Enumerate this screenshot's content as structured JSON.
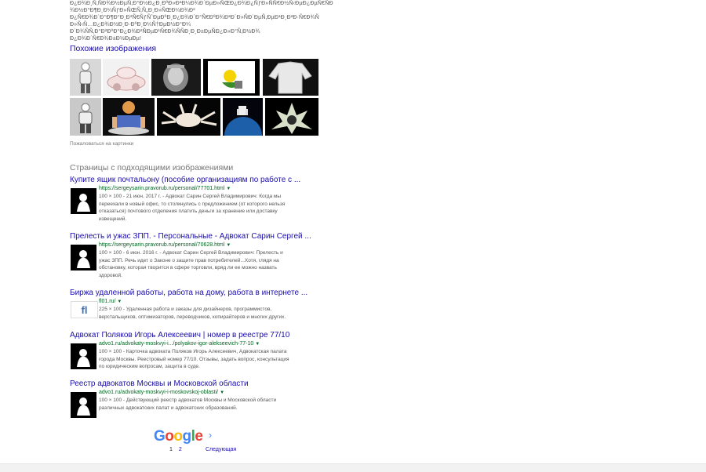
{
  "garbled_text": {
    "line1": "Ð¿Ð¾Ð¸Ñ‚ÑÐ¾Ð½ÐµÑ‚Ð°Ð½Ð¿Ð¸ÐºÐ»Ð²Ð¼Ð¾Ð´ÐµÐ»ÑŒÐ¿Ð¾Ð¿ÑƒÐ»ÑÑ€Ð½Ñ‹ÐµÐ¿ÐµÑ€ÑÐ¾Ð½Ð°Ð¶Ð¸Ð¼ÑƒÐ»ÑŒÑ‚Ñ„Ð¸Ð»ÑŒÐ¼Ð¾Ð²",
    "line2": "Ð¿Ñ€Ð¾Ð´Ð°Ð¶Ð°Ð¸Ð³Ñ€ÑƒÑˆÐµÐºÐ¸Ð¿Ð¾Ð´Ð°Ñ€ÐºÐ¾Ð²Ð´Ð»ÑÐ´ÐµÑ‚ÐµÐ¹Ð¸Ð²Ð·Ñ€Ð¾ÑÐ»Ñ‹Ñ…Ð¿Ð¾Ð½Ð¸Ð·ÐºÐ¸Ð¼Ñ†ÐµÐ½Ð°Ð¼",
    "line3": "Ð´Ð¾ÑÑ‚Ð°Ð²ÐºÐ°Ð¿Ð¾Ð²ÑÐµÐ¹Ñ€Ð¾ÑÑÐ¸Ð¸Ð±ÐµÑÐ¿Ð»Ð°Ñ‚Ð½Ð¾",
    "line4": "Ð¿Ð¾Ð´Ñ€Ð¾Ð±Ð½ÐµÐµ!"
  },
  "similar_images": {
    "title": "Похожие изображения",
    "complain_label": "Пожаловаться на картинки"
  },
  "pages_section": {
    "title": "Страницы с подходящими изображениями",
    "results": [
      {
        "title": "Купите ящик почтальону (пособие организациям по работе с ...",
        "url": "https://sergeysarin.pravorub.ru/personal/77701.html",
        "meta": "100 × 100 - 21 июн. 2017 г. - Адвокат Сарин Сергей Владимирович: Когда мы",
        "snippet_line2": "переехали в новый офис, то столкнулись с предложением (от которого нельзя",
        "snippet_line3": "отказаться) почтового отделения платить деньги за хранение или доставку",
        "snippet_line4": "извещений."
      },
      {
        "title": "Прелесть и ужас ЗПП. - Персональные - Адвокат Сарин Сергей ...",
        "url": "https://sergeysarin.pravorub.ru/personal/70628.html",
        "meta": "100 × 100 - 6 июн. 2016 г. - Адвокат Сарин Сергей Владимирович: Прелесть и",
        "snippet_line2": "ужас ЗПП. Речь идет о Законе о защите прав потребителей...Хотя, глядя на",
        "snippet_line3": "обстановку, которая творится в сфере торговли, вряд ли ее можно назвать",
        "snippet_line4": "здоровой."
      },
      {
        "title": "Биржа удаленной работы, работа на дому, работа в интернете ...",
        "url": "fl01.ru/",
        "meta": "225 × 100 - Удаленная работа и заказы для дизайнеров, программистов,",
        "snippet_line2": "верстальщиков, оптимизаторов, переводчиков, копирайтеров и многих других.",
        "snippet_line3": "",
        "snippet_line4": ""
      },
      {
        "title": "Адвокат Поляков Игорь Алексеевич | номер в реестре 77/10",
        "url": "advo1.ru/advokaty-moskvyi-i.../polyakov-igor-alekseevich-77-10",
        "meta": "100 × 100 - Карточка адвоката Поляков Игорь Алексеевич, Адвокатская палата",
        "snippet_line2": "города Москвы. Реестровый номер 77/10. Отзывы, задать вопрос, консультация",
        "snippet_line3": "по юридическим вопросам, защита в суде.",
        "snippet_line4": ""
      },
      {
        "title": "Реестр адвокатов Москвы и Московской области",
        "url": "advo1.ru/advokaty-moskvyi-i-moskovskoj-oblasti/",
        "meta": "100 × 100 - Действующий реестр адвокатов Москвы и Московской области",
        "snippet_line2": "различных адвокатских палат и адвокатских образований.",
        "snippet_line3": "",
        "snippet_line4": ""
      }
    ]
  },
  "pagination": {
    "logo_text": "Google",
    "page1": "1",
    "page2": "2",
    "next_label": "Следующая",
    "arrow": "›"
  },
  "colors": {
    "link": "#1a0dab",
    "url_green": "#006621",
    "snippet": "#545454"
  }
}
